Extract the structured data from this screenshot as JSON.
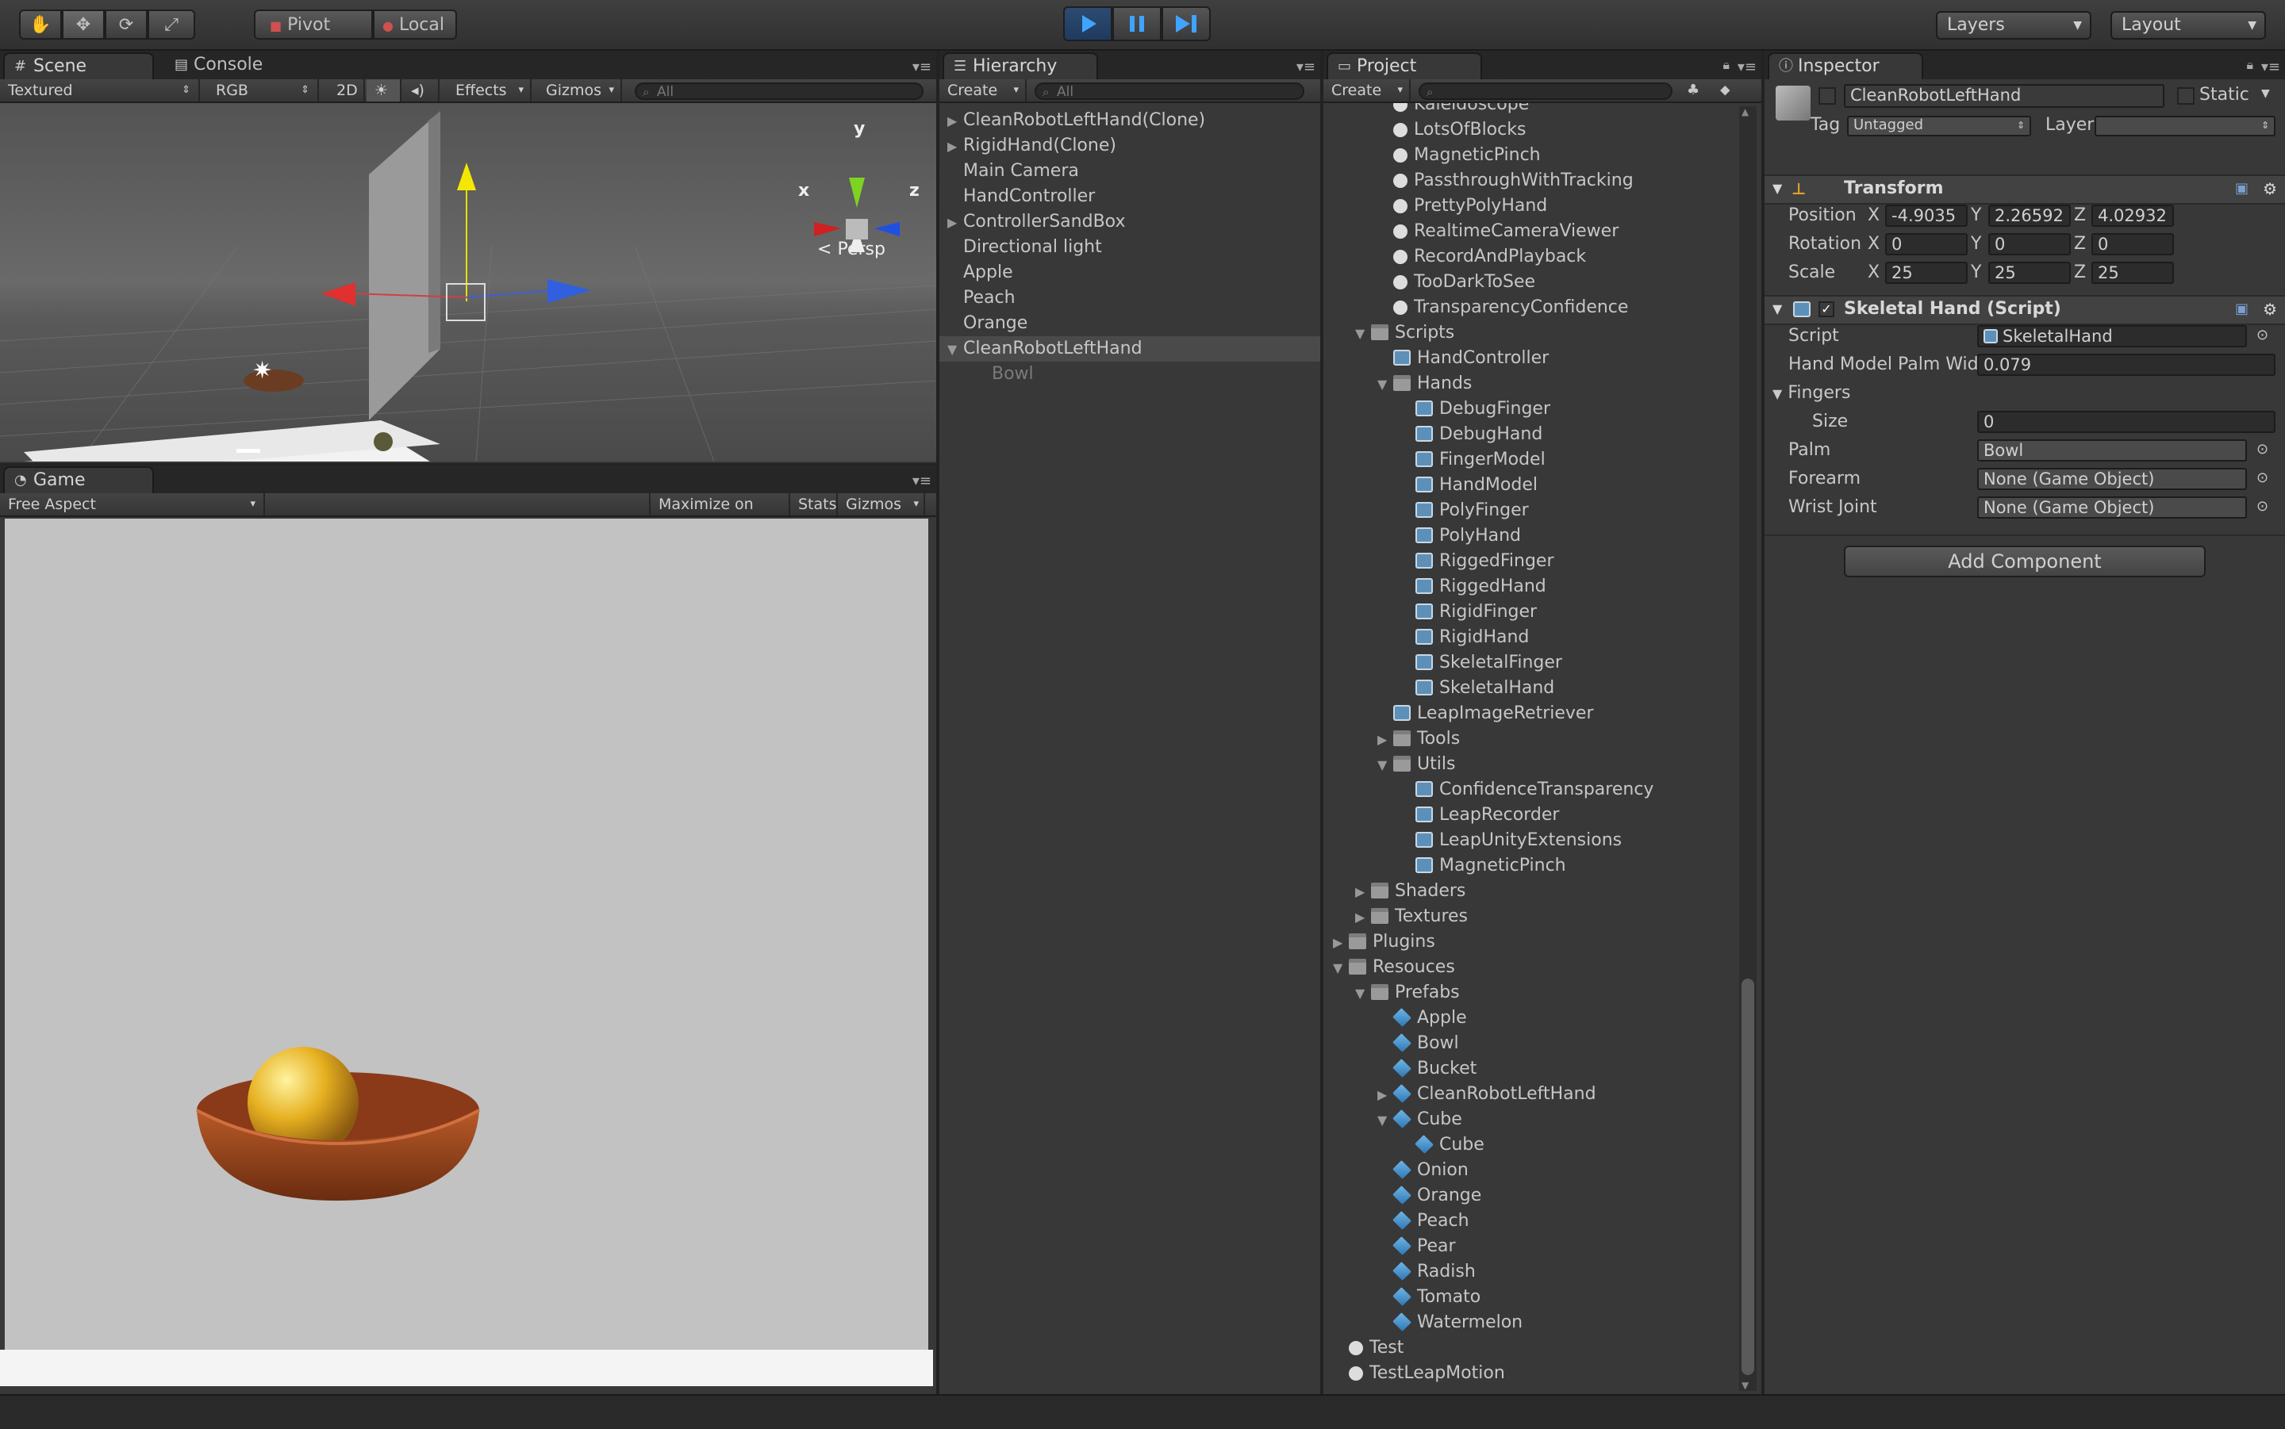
{
  "toolbar": {
    "pivot": "Pivot",
    "local": "Local",
    "layers": "Layers",
    "layout": "Layout"
  },
  "scene": {
    "tab": "Scene",
    "console_tab": "Console",
    "shading": "Textured",
    "render": "RGB",
    "mode2d": "2D",
    "effects": "Effects",
    "gizmos": "Gizmos",
    "search_placeholder": "All",
    "persp": "Persp",
    "axis_x": "x",
    "axis_y": "y",
    "axis_z": "z"
  },
  "game": {
    "tab": "Game",
    "aspect": "Free Aspect",
    "maximize": "Maximize on Play",
    "stats": "Stats",
    "gizmos": "Gizmos"
  },
  "hierarchy": {
    "tab": "Hierarchy",
    "create": "Create",
    "search_placeholder": "All",
    "items": [
      {
        "label": "CleanRobotLeftHand(Clone)",
        "arrow": "▶"
      },
      {
        "label": "RigidHand(Clone)",
        "arrow": "▶"
      },
      {
        "label": "Main Camera",
        "arrow": ""
      },
      {
        "label": "HandController",
        "arrow": ""
      },
      {
        "label": "ControllerSandBox",
        "arrow": "▶"
      },
      {
        "label": "Directional light",
        "arrow": ""
      },
      {
        "label": "Apple",
        "arrow": ""
      },
      {
        "label": "Peach",
        "arrow": ""
      },
      {
        "label": "Orange",
        "arrow": ""
      },
      {
        "label": "CleanRobotLeftHand",
        "arrow": "▼"
      },
      {
        "label": "Bowl",
        "arrow": ""
      }
    ]
  },
  "project": {
    "tab": "Project",
    "create": "Create",
    "items": [
      {
        "label": "Kaleidoscope",
        "indent": 3,
        "arrow": "",
        "icon": "scene"
      },
      {
        "label": "LotsOfBlocks",
        "indent": 3,
        "arrow": "",
        "icon": "scene"
      },
      {
        "label": "MagneticPinch",
        "indent": 3,
        "arrow": "",
        "icon": "scene"
      },
      {
        "label": "PassthroughWithTracking",
        "indent": 3,
        "arrow": "",
        "icon": "scene"
      },
      {
        "label": "PrettyPolyHand",
        "indent": 3,
        "arrow": "",
        "icon": "scene"
      },
      {
        "label": "RealtimeCameraViewer",
        "indent": 3,
        "arrow": "",
        "icon": "scene"
      },
      {
        "label": "RecordAndPlayback",
        "indent": 3,
        "arrow": "",
        "icon": "scene"
      },
      {
        "label": "TooDarkToSee",
        "indent": 3,
        "arrow": "",
        "icon": "scene"
      },
      {
        "label": "TransparencyConfidence",
        "indent": 3,
        "arrow": "",
        "icon": "scene"
      },
      {
        "label": "Scripts",
        "indent": 2,
        "arrow": "▼",
        "icon": "folder"
      },
      {
        "label": "HandController",
        "indent": 3,
        "arrow": "",
        "icon": "cs"
      },
      {
        "label": "Hands",
        "indent": 3,
        "arrow": "▼",
        "icon": "folder"
      },
      {
        "label": "DebugFinger",
        "indent": 4,
        "arrow": "",
        "icon": "cs"
      },
      {
        "label": "DebugHand",
        "indent": 4,
        "arrow": "",
        "icon": "cs"
      },
      {
        "label": "FingerModel",
        "indent": 4,
        "arrow": "",
        "icon": "cs"
      },
      {
        "label": "HandModel",
        "indent": 4,
        "arrow": "",
        "icon": "cs"
      },
      {
        "label": "PolyFinger",
        "indent": 4,
        "arrow": "",
        "icon": "cs"
      },
      {
        "label": "PolyHand",
        "indent": 4,
        "arrow": "",
        "icon": "cs"
      },
      {
        "label": "RiggedFinger",
        "indent": 4,
        "arrow": "",
        "icon": "cs"
      },
      {
        "label": "RiggedHand",
        "indent": 4,
        "arrow": "",
        "icon": "cs"
      },
      {
        "label": "RigidFinger",
        "indent": 4,
        "arrow": "",
        "icon": "cs"
      },
      {
        "label": "RigidHand",
        "indent": 4,
        "arrow": "",
        "icon": "cs"
      },
      {
        "label": "SkeletalFinger",
        "indent": 4,
        "arrow": "",
        "icon": "cs"
      },
      {
        "label": "SkeletalHand",
        "indent": 4,
        "arrow": "",
        "icon": "cs"
      },
      {
        "label": "LeapImageRetriever",
        "indent": 3,
        "arrow": "",
        "icon": "cs"
      },
      {
        "label": "Tools",
        "indent": 3,
        "arrow": "▶",
        "icon": "folder"
      },
      {
        "label": "Utils",
        "indent": 3,
        "arrow": "▼",
        "icon": "folder"
      },
      {
        "label": "ConfidenceTransparency",
        "indent": 4,
        "arrow": "",
        "icon": "cs"
      },
      {
        "label": "LeapRecorder",
        "indent": 4,
        "arrow": "",
        "icon": "cs"
      },
      {
        "label": "LeapUnityExtensions",
        "indent": 4,
        "arrow": "",
        "icon": "cs"
      },
      {
        "label": "MagneticPinch",
        "indent": 4,
        "arrow": "",
        "icon": "cs"
      },
      {
        "label": "Shaders",
        "indent": 2,
        "arrow": "▶",
        "icon": "folder"
      },
      {
        "label": "Textures",
        "indent": 2,
        "arrow": "▶",
        "icon": "folder"
      },
      {
        "label": "Plugins",
        "indent": 1,
        "arrow": "▶",
        "icon": "folder"
      },
      {
        "label": "Resouces",
        "indent": 1,
        "arrow": "▼",
        "icon": "folder"
      },
      {
        "label": "Prefabs",
        "indent": 2,
        "arrow": "▼",
        "icon": "folder"
      },
      {
        "label": "Apple",
        "indent": 3,
        "arrow": "",
        "icon": "cube"
      },
      {
        "label": "Bowl",
        "indent": 3,
        "arrow": "",
        "icon": "cube"
      },
      {
        "label": "Bucket",
        "indent": 3,
        "arrow": "",
        "icon": "cube"
      },
      {
        "label": "CleanRobotLeftHand",
        "indent": 3,
        "arrow": "▶",
        "icon": "cube"
      },
      {
        "label": "Cube",
        "indent": 3,
        "arrow": "▼",
        "icon": "cube"
      },
      {
        "label": "Cube",
        "indent": 4,
        "arrow": "",
        "icon": "cube"
      },
      {
        "label": "Onion",
        "indent": 3,
        "arrow": "",
        "icon": "cube"
      },
      {
        "label": "Orange",
        "indent": 3,
        "arrow": "",
        "icon": "cube"
      },
      {
        "label": "Peach",
        "indent": 3,
        "arrow": "",
        "icon": "cube"
      },
      {
        "label": "Pear",
        "indent": 3,
        "arrow": "",
        "icon": "cube"
      },
      {
        "label": "Radish",
        "indent": 3,
        "arrow": "",
        "icon": "cube"
      },
      {
        "label": "Tomato",
        "indent": 3,
        "arrow": "",
        "icon": "cube"
      },
      {
        "label": "Watermelon",
        "indent": 3,
        "arrow": "",
        "icon": "cube"
      },
      {
        "label": "Test",
        "indent": 1,
        "arrow": "",
        "icon": "scene"
      },
      {
        "label": "TestLeapMotion",
        "indent": 1,
        "arrow": "",
        "icon": "scene"
      }
    ]
  },
  "inspector": {
    "tab": "Inspector",
    "object_name": "CleanRobotLeftHand",
    "static": "Static",
    "tag_label": "Tag",
    "tag_value": "Untagged",
    "layer_label": "Layer",
    "layer_value": "",
    "transform": {
      "title": "Transform",
      "position_label": "Position",
      "rotation_label": "Rotation",
      "scale_label": "Scale",
      "x": "X",
      "y": "Y",
      "z": "Z",
      "position": [
        "-4.9035",
        "2.26592",
        "4.02932"
      ],
      "rotation": [
        "0",
        "0",
        "0"
      ],
      "scale": [
        "25",
        "25",
        "25"
      ]
    },
    "skeletal": {
      "title": "Skeletal Hand (Script)",
      "script_label": "Script",
      "script_value": "SkeletalHand",
      "palm_width_label": "Hand Model Palm Widt",
      "palm_width_value": "0.079",
      "fingers_label": "Fingers",
      "size_label": "Size",
      "size_value": "0",
      "palm_label": "Palm",
      "palm_value": "Bowl",
      "forearm_label": "Forearm",
      "forearm_value": "None (Game Object)",
      "wrist_label": "Wrist Joint",
      "wrist_value": "None (Game Object)"
    },
    "add_component": "Add Component"
  }
}
